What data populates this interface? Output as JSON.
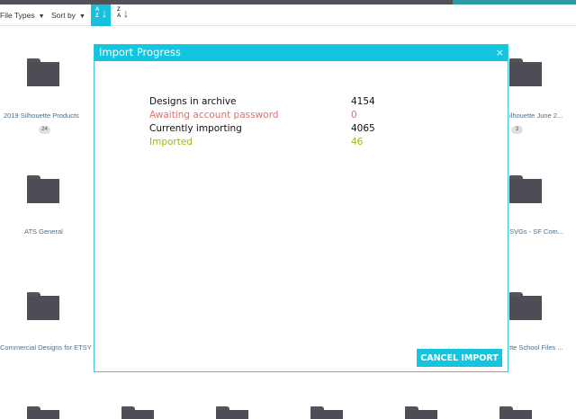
{
  "colors": {
    "accent": "#14c5df",
    "label_default": "#111111",
    "label_awaiting": "#e0706b",
    "label_imported": "#a7b21e",
    "folder": "#4d4e55"
  },
  "toolbar": {
    "file_types_label": "File Types",
    "sort_by_label": "Sort by",
    "sort_az_glyph": "A\nZ",
    "sort_za_glyph": "Z\nA",
    "caret": "▼"
  },
  "folders": [
    {
      "label": "2019 Silhouette Products",
      "badge": "24"
    },
    {
      "label": "ilhouette June 2...",
      "badge": "3"
    },
    {
      "label": "ATS General"
    },
    {
      "label": "SVGs - SF Com..."
    },
    {
      "label": "Commercial Designs for ETSY"
    },
    {
      "label": "tte School Files ..."
    }
  ],
  "modal": {
    "title": "Import Progress",
    "close_glyph": "×",
    "rows": [
      {
        "label": "Designs in archive",
        "value": "4154"
      },
      {
        "label": "Awaiting account password",
        "value": "0"
      },
      {
        "label": "Currently importing",
        "value": "4065"
      },
      {
        "label": "Imported",
        "value": "46"
      }
    ],
    "cancel_label": "CANCEL IMPORT"
  }
}
